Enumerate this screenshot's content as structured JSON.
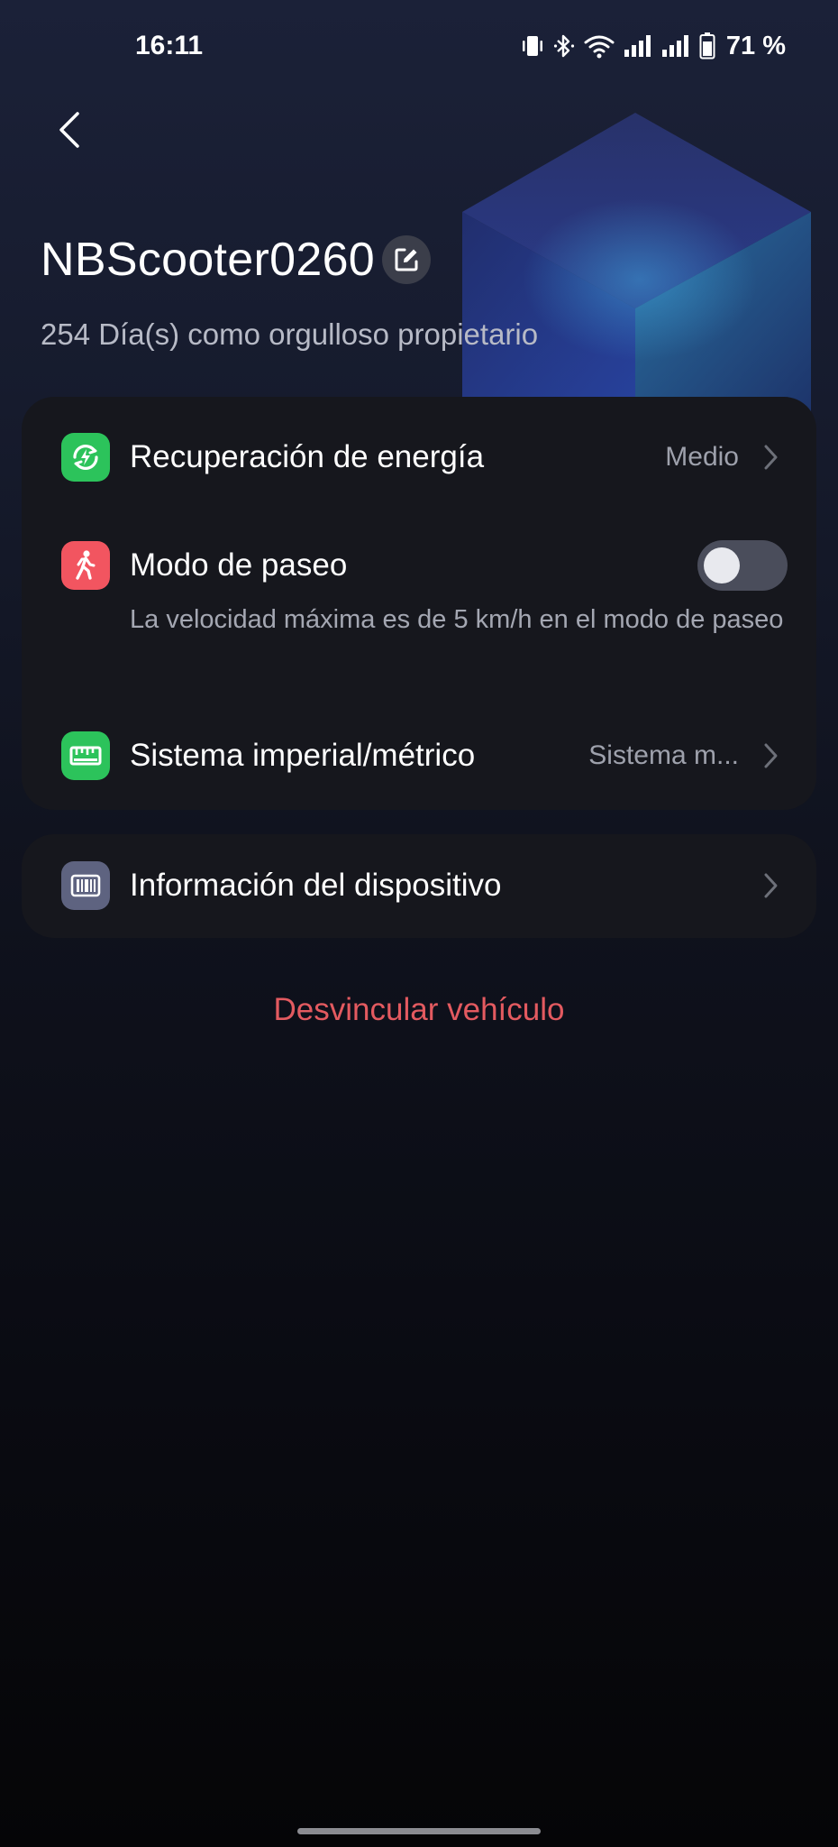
{
  "status_bar": {
    "time": "16:11",
    "battery": "71 %",
    "icons": [
      "vibrate-icon",
      "bluetooth-icon",
      "wifi-icon",
      "signal-icon",
      "signal-icon",
      "battery-icon"
    ]
  },
  "header": {
    "device_name": "NBScooter0260",
    "owner_text": "254 Día(s) como orgulloso propietario"
  },
  "settings": {
    "energy_recovery": {
      "label": "Recuperación de energía",
      "value": "Medio",
      "icon": "energy-recovery-icon",
      "color": "#2cc35b"
    },
    "walk_mode": {
      "label": "Modo de paseo",
      "description": "La velocidad máxima es de 5 km/h en el modo de paseo",
      "enabled": false,
      "icon": "walking-person-icon",
      "color": "#f25560"
    },
    "units": {
      "label": "Sistema imperial/métrico",
      "value": "Sistema m...",
      "icon": "ruler-icon",
      "color": "#2cc35b"
    }
  },
  "info": {
    "device_info": {
      "label": "Información del dispositivo",
      "icon": "barcode-icon",
      "color": "#5e6380"
    }
  },
  "actions": {
    "unlink": "Desvincular vehículo"
  }
}
